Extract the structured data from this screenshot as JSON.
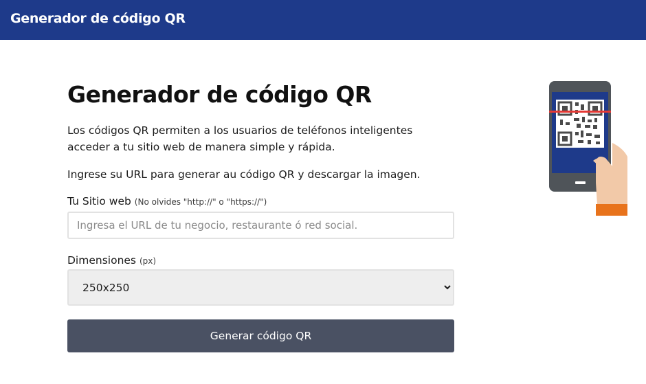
{
  "header": {
    "title": "Generador de código QR"
  },
  "main": {
    "title": "Generador de código QR",
    "description": "Los códigos QR permiten a los usuarios de teléfonos inteligentes acceder a tu sitio web de manera simple y rápida.",
    "instruction": "Ingrese su URL para generar au código QR y descargar la imagen.",
    "url_field": {
      "label": "Tu Sitio web",
      "hint": "(No olvides \"http://\" o \"https://\")",
      "placeholder": "Ingresa el URL de tu negocio, restaurante ó red social.",
      "value": ""
    },
    "dimensions_field": {
      "label": "Dimensiones",
      "hint": "(px)",
      "selected": "250x250"
    },
    "generate_button": "Generar código QR"
  },
  "colors": {
    "header_bg": "#1e3a8a",
    "button_bg": "#4a5163",
    "phone_screen": "#1e3a8a",
    "scan_line": "#e53935",
    "hand": "#f2c9a8",
    "sleeve": "#e8731c"
  },
  "icons": [
    "phone-qr-scan-illustration"
  ]
}
